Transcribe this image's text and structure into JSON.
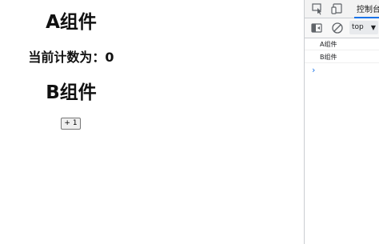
{
  "app": {
    "component_a_title": "A组件",
    "count_text": "当前计数为：0",
    "component_b_title": "B组件",
    "increment_button_label": "+ 1"
  },
  "devtools": {
    "tabs": {
      "inspect_icon": "inspect-element-icon",
      "device_icon": "device-toolbar-icon",
      "console_label": "控制台"
    },
    "toolbar": {
      "sidebar_icon": "show-sidebar-icon",
      "clear_icon": "clear-console-icon",
      "context_value": "top"
    },
    "console_lines": [
      "A组件",
      "B组件"
    ],
    "prompt_symbol": "›"
  },
  "colors": {
    "accent": "#1a73e8",
    "border": "#cacdd1"
  }
}
